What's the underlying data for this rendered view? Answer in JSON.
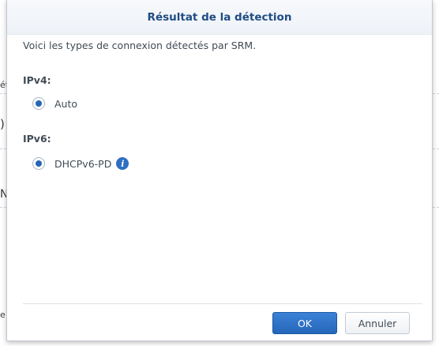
{
  "background": {
    "fragments": [
      "ét",
      ")",
      "N",
      "e"
    ]
  },
  "dialog": {
    "title": "Résultat de la détection",
    "intro": "Voici les types de connexion détectés par SRM.",
    "ipv4": {
      "label": "IPv4:",
      "option": "Auto",
      "selected": true
    },
    "ipv6": {
      "label": "IPv6:",
      "option": "DHCPv6-PD",
      "selected": true,
      "info_icon": "info-icon"
    },
    "buttons": {
      "ok": "OK",
      "cancel": "Annuler"
    }
  },
  "colors": {
    "title": "#1f4c82",
    "primary_button": "#2566ba",
    "radio_selected": "#2466b4"
  }
}
